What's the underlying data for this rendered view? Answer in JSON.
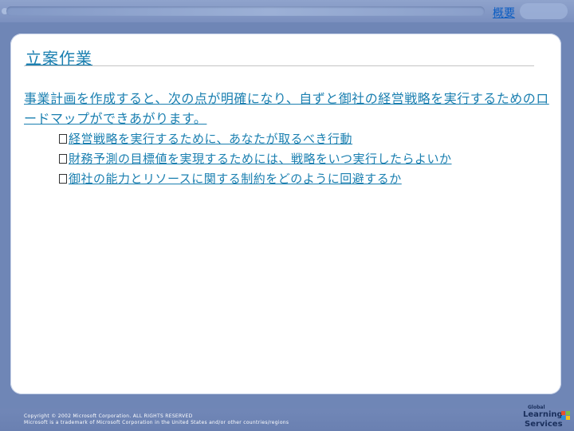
{
  "nav": {
    "link": "概要"
  },
  "slide": {
    "title": "立案作業",
    "intro": "事業計画を作成すると、次の点が明確になり、自ずと御社の経営戦略を実行するためのロードマップができあがります。",
    "bullets": [
      "経営戦略を実行するために、あなたが取るべき行動",
      "財務予測の目標値を実現するためには、戦略をいつ実行したらよいか",
      "御社の能力とリソースに関する制約をどのように回避するか"
    ]
  },
  "footer": {
    "copyright_line1": "Copyright © 2002 Microsoft Corporation. ALL RIGHTS RESERVED",
    "copyright_line2": "Microsoft is a trademark of Microsoft Corporation in the United States and/or other countries/regions"
  },
  "logo": {
    "line1": "Global",
    "line2": "Learning",
    "line3": "Services"
  },
  "colors": {
    "background": "#6f86b6",
    "text": "#1a7fb0",
    "link": "#0a5cc2"
  }
}
